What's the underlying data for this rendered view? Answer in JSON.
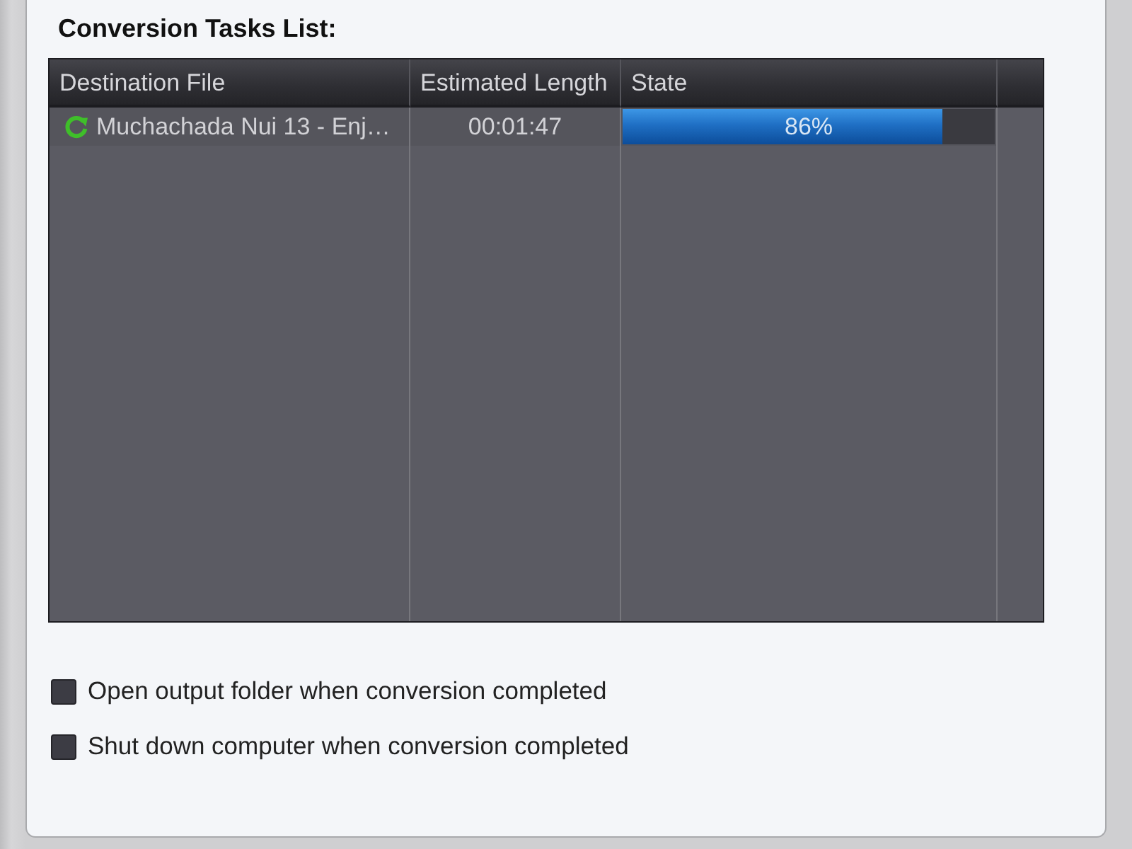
{
  "section_title": "Conversion Tasks List:",
  "table": {
    "columns": [
      "Destination File",
      "Estimated Length",
      "State"
    ],
    "rows": [
      {
        "destination_file": "Muchachada Nui 13 - Enj…",
        "estimated_length": "00:01:47",
        "state": {
          "level": 0.86,
          "reading": "86%"
        }
      }
    ]
  },
  "options": [
    {
      "label": "Open output folder when conversion completed",
      "checked": false
    },
    {
      "label": "Shut down computer when conversion completed",
      "checked": false
    }
  ]
}
